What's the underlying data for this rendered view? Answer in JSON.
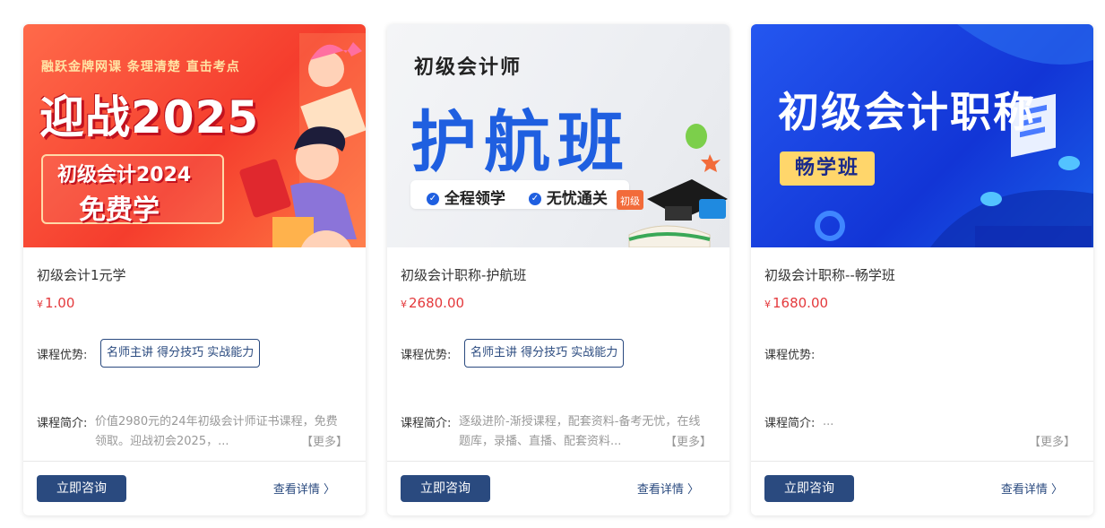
{
  "colors": {
    "price": "#e4393c",
    "accent": "#2a4a7f",
    "muted": "#999999"
  },
  "labels": {
    "advantage": "课程优势:",
    "intro": "课程简介:",
    "more": "【更多】",
    "consult": "立即咨询",
    "detail": "查看详情 〉"
  },
  "cards": [
    {
      "banner": {
        "tagline": "融跃金牌网课 条理清楚 直击考点",
        "headline": "迎战2025",
        "sub1": "初级会计2024",
        "sub2": "免费学"
      },
      "title": "初级会计1元学",
      "currency": "¥",
      "price": "1.00",
      "advantage": "名师主讲 得分技巧 实战能力",
      "intro": "价值2980元的24年初级会计师证书课程，免费领取。迎战初会2025，..."
    },
    {
      "banner": {
        "small": "初级会计师",
        "big": "护航班",
        "check1": "全程领学",
        "check2": "无忧通关",
        "badge": "初级"
      },
      "title": "初级会计职称-护航班",
      "currency": "¥",
      "price": "2680.00",
      "advantage": "名师主讲 得分技巧 实战能力",
      "intro": "逐级进阶-渐授课程，配套资料-备考无忧，在线题库，录播、直播、配套资料..."
    },
    {
      "banner": {
        "title": "初级会计职称",
        "badge": "畅学班"
      },
      "title": "初级会计职称--畅学班",
      "currency": "¥",
      "price": "1680.00",
      "advantage": "",
      "intro": "..."
    }
  ]
}
